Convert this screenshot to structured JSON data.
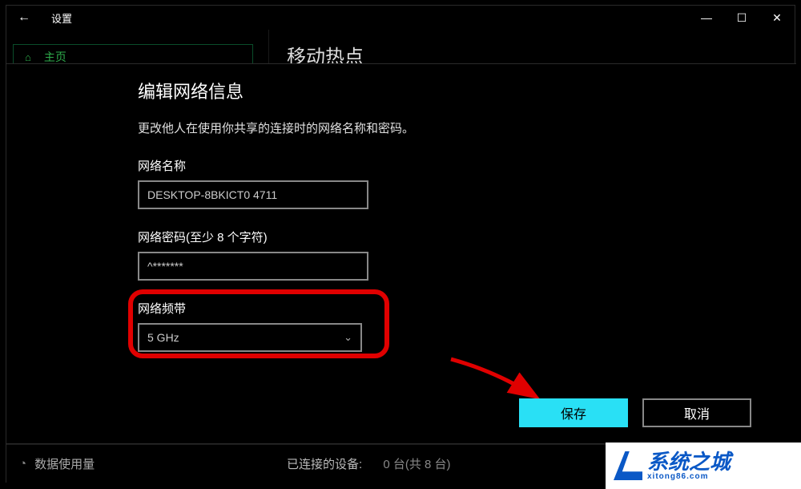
{
  "window": {
    "title": "设置",
    "back_icon": "←",
    "minimize_icon": "—",
    "maximize_icon": "☐",
    "close_icon": "✕"
  },
  "sidebar": {
    "home_icon": "⌂",
    "home_label": "主页"
  },
  "main": {
    "heading": "移动热点"
  },
  "dialog": {
    "title": "编辑网络信息",
    "description": "更改他人在使用你共享的连接时的网络名称和密码。",
    "network_name_label": "网络名称",
    "network_name_value": "DESKTOP-8BKICT0 4711",
    "network_password_label": "网络密码(至少 8 个字符)",
    "network_password_value": "^*******",
    "network_band_label": "网络频带",
    "network_band_value": "5 GHz",
    "chevron": "⌄",
    "save_label": "保存",
    "cancel_label": "取消"
  },
  "bottombar": {
    "data_usage_icon": "◔",
    "data_usage_label": "数据使用量",
    "connected_devices_label": "已连接的设备:",
    "connected_devices_value": "0 台(共 8 台)"
  },
  "watermark": {
    "logo_name": "shield-logo",
    "brand_big": "系统之城",
    "brand_small": "xitong86.com"
  },
  "annotation": {
    "arrow_color": "#e00000",
    "highlight_color": "#e00000"
  }
}
